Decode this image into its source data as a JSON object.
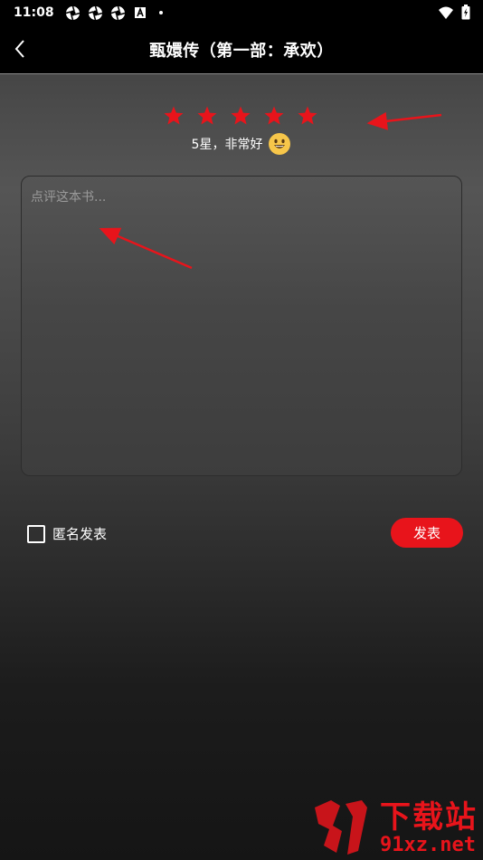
{
  "status_bar": {
    "time": "11:08",
    "icons": [
      "aperture-icon",
      "aperture-icon",
      "aperture-icon",
      "a-box-icon",
      "dot-icon"
    ],
    "right_icons": [
      "wifi-icon",
      "battery-charging-icon"
    ]
  },
  "header": {
    "title": "甄嬛传（第一部：承欢）",
    "back_icon": "chevron-left-icon"
  },
  "rating": {
    "stars": 5,
    "max_stars": 5,
    "star_color": "#e8141b",
    "text": "5星，非常好",
    "emoji": "grinning-face-icon"
  },
  "review": {
    "placeholder": "点评这本书...",
    "value": ""
  },
  "options": {
    "anonymous_label": "匿名发表",
    "anonymous_checked": false
  },
  "actions": {
    "publish_label": "发表",
    "publish_color": "#e8141b"
  },
  "watermark": {
    "line1": "下载站",
    "line2": "91xz.net"
  },
  "annotations": {
    "arrow_color": "#e8141b"
  }
}
